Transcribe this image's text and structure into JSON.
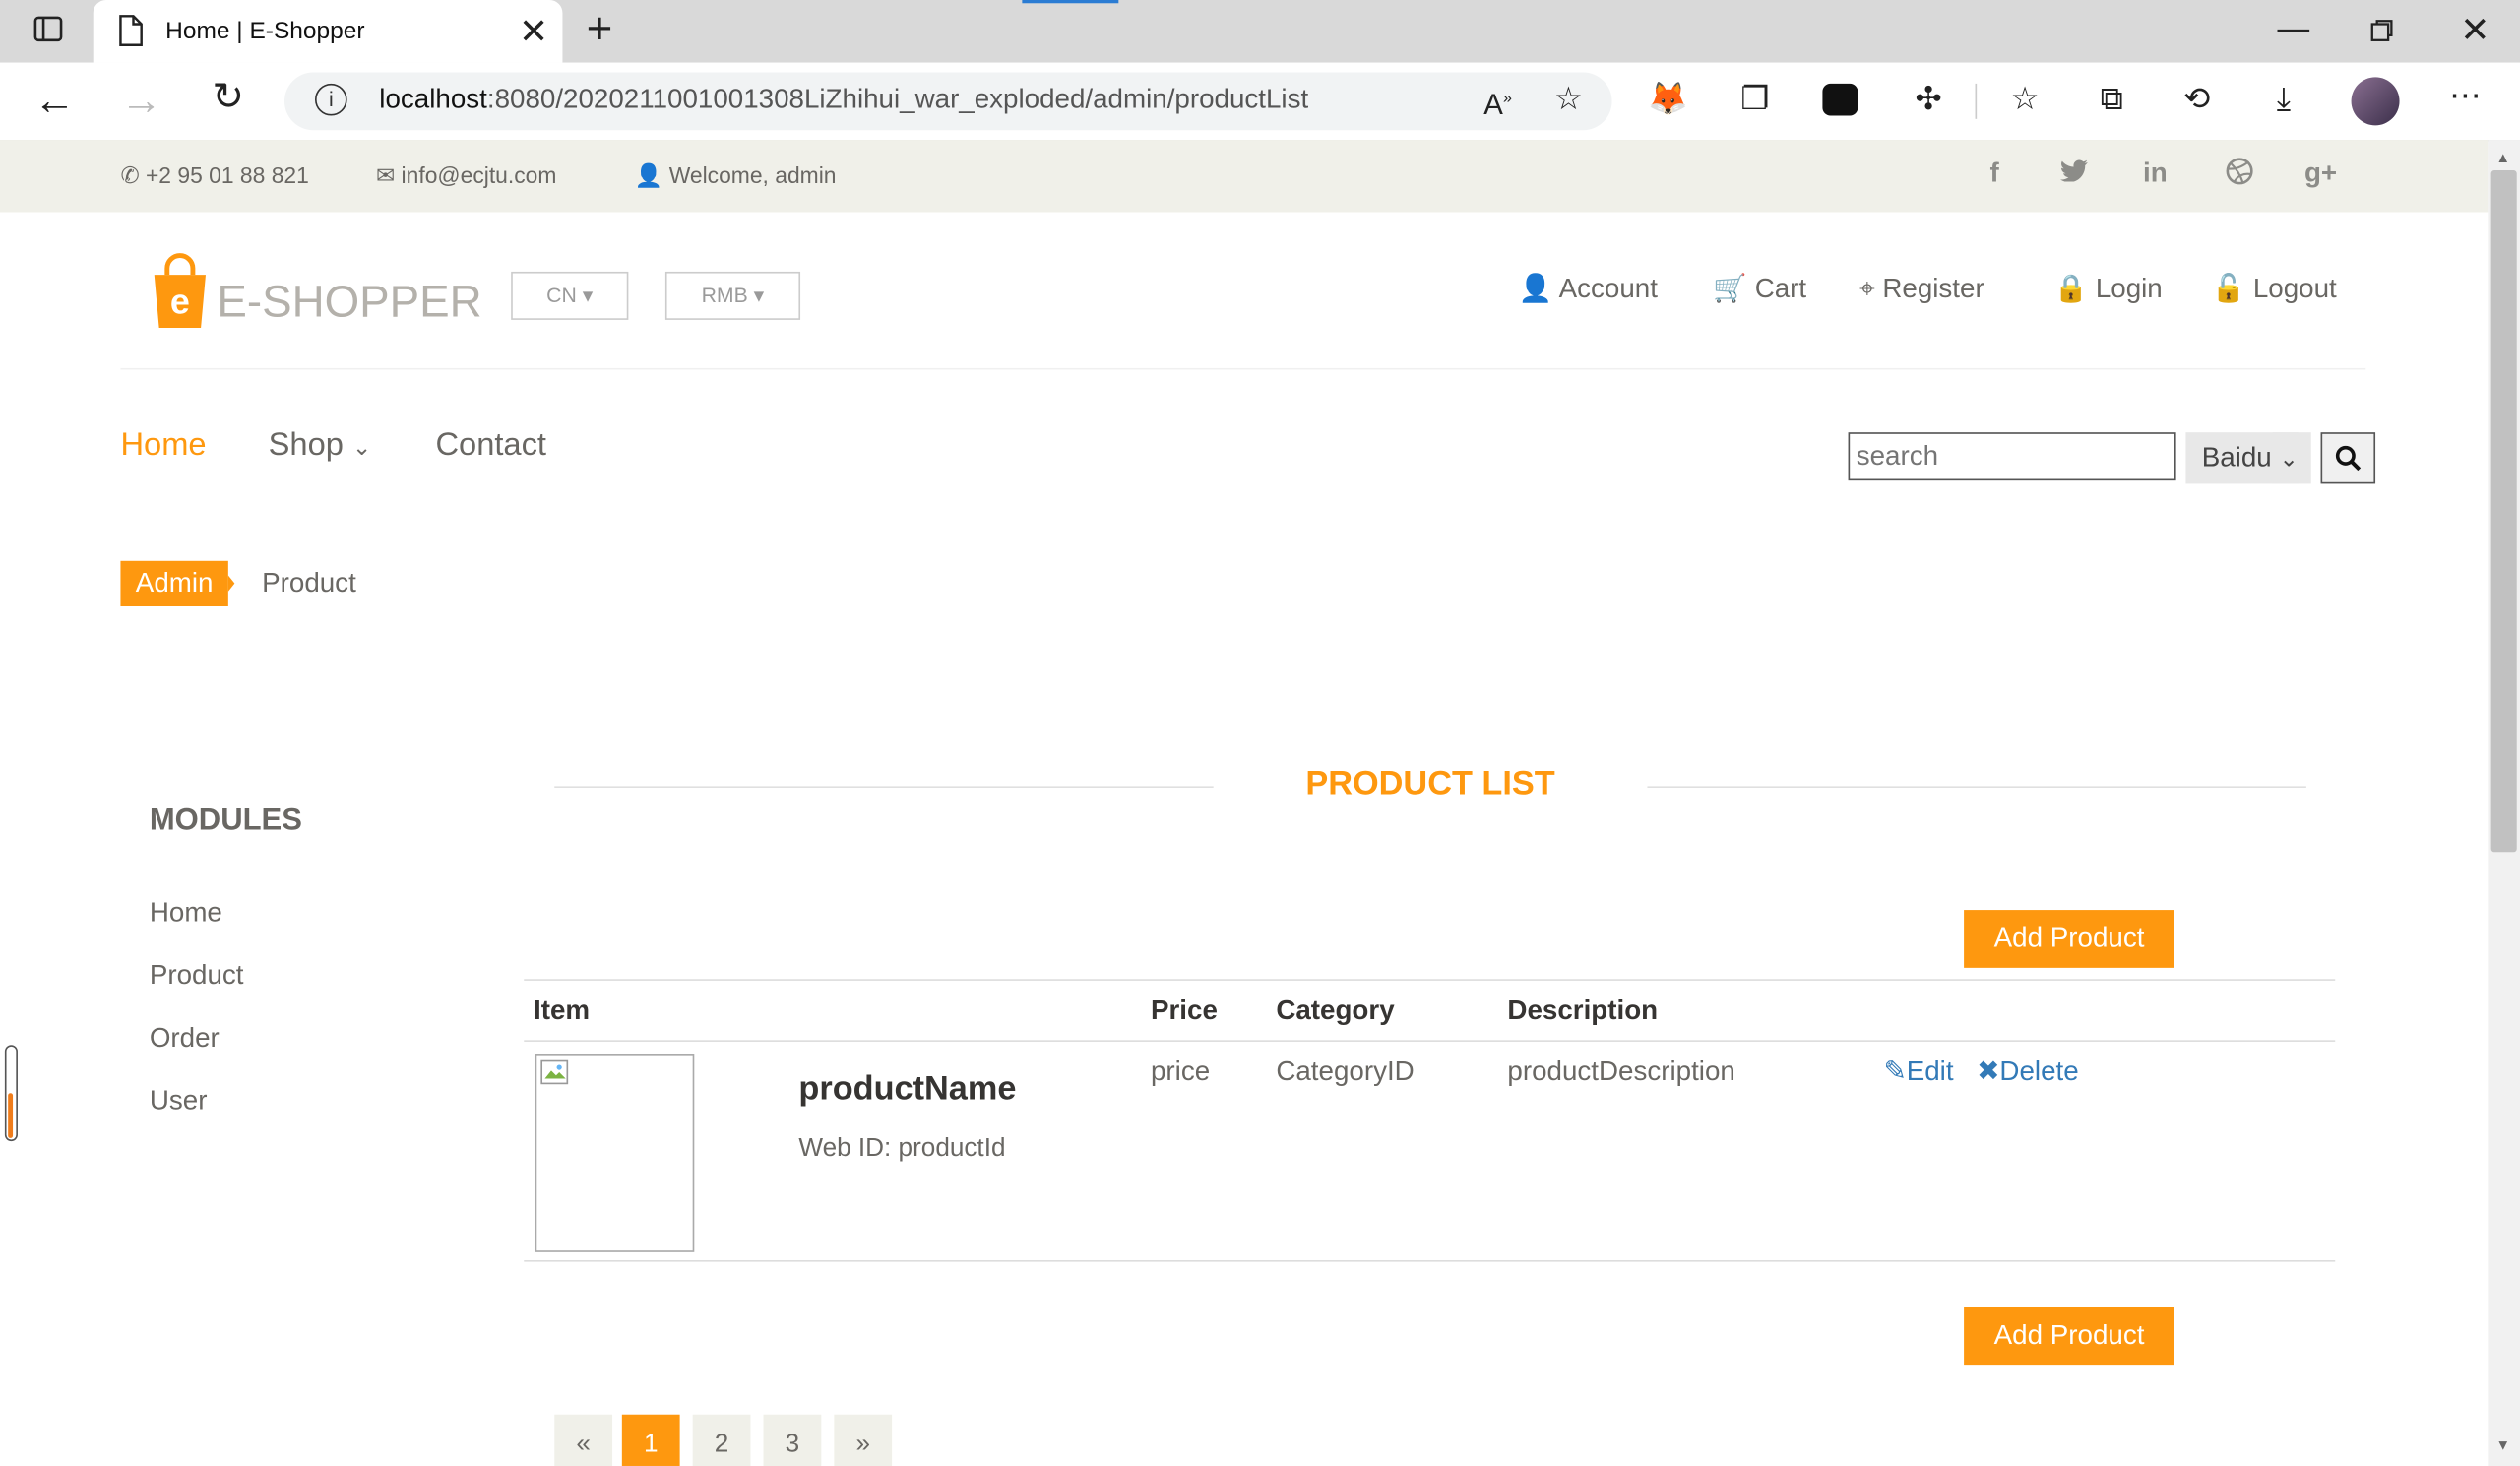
{
  "browser": {
    "tab_title": "Home | E-Shopper",
    "url_host": "localhost",
    "url_rest": ":8080/2020211001001308LiZhihui_war_exploded/admin/productList"
  },
  "topbar": {
    "phone": "+2 95 01 88 821",
    "email": "info@ecjtu.com",
    "welcome": "Welcome, admin",
    "social": [
      "f",
      "t",
      "in",
      "dribbble",
      "g+"
    ]
  },
  "header": {
    "logo_letter": "e",
    "logo_text": "E-SHOPPER",
    "lang": "CN",
    "currency": "RMB",
    "links": [
      "Account",
      "Cart",
      "Register",
      "Login",
      "Logout"
    ]
  },
  "nav": {
    "items": [
      "Home",
      "Shop",
      "Contact"
    ],
    "search_placeholder": "search",
    "engine": "Baidu"
  },
  "breadcrumb": {
    "active": "Admin",
    "current": "Product"
  },
  "sidebar": {
    "title": "MODULES",
    "items": [
      "Home",
      "Product",
      "Order",
      "User"
    ]
  },
  "main": {
    "title": "PRODUCT LIST",
    "add_label": "Add Product",
    "columns": [
      "Item",
      "Price",
      "Category",
      "Description"
    ],
    "row": {
      "name": "productName",
      "web_id": "Web ID: productId",
      "price": "price",
      "category": "CategoryID",
      "description": "productDescription",
      "edit": "Edit",
      "delete": "Delete"
    },
    "pagination": [
      "«",
      "1",
      "2",
      "3",
      "»"
    ]
  },
  "colors": {
    "accent": "#fe980f",
    "link": "#337ab7",
    "topbar_bg": "#f0f0e9"
  }
}
